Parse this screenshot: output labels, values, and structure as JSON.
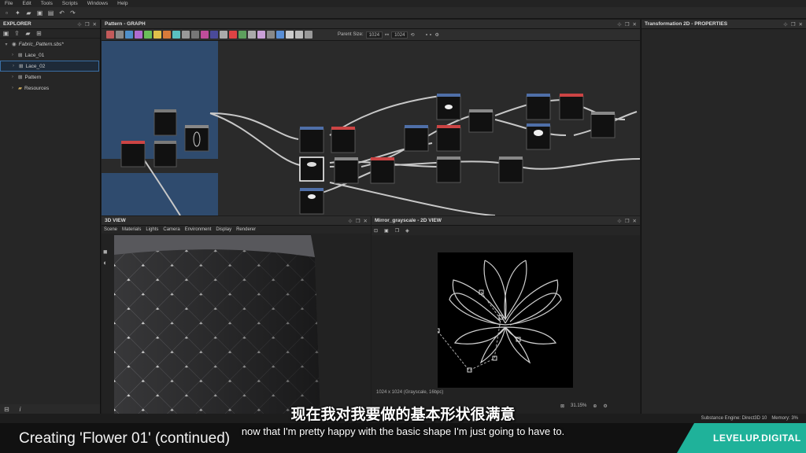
{
  "menu": [
    "File",
    "Edit",
    "Tools",
    "Scripts",
    "Windows",
    "Help"
  ],
  "explorer": {
    "title": "EXPLORER",
    "package": "Fabric_Pattern.sbs*",
    "items": [
      {
        "label": "Lace_01"
      },
      {
        "label": "Lace_02"
      },
      {
        "label": "Pattern"
      },
      {
        "label": "Resources"
      }
    ]
  },
  "graph": {
    "title": "Pattern - GRAPH",
    "parent_size_label": "Parent Size:",
    "parent_size_value": "1024",
    "size_value": "1024"
  },
  "view3d": {
    "title": "3D VIEW",
    "tabs": [
      "Scene",
      "Materials",
      "Lights",
      "Camera",
      "Environment",
      "Display",
      "Renderer"
    ]
  },
  "view2d": {
    "title": "Mirror_grayscale - 2D VIEW",
    "info": "1024 x 1024 (Grayscale, 16bpc)",
    "zoom": "31.15%"
  },
  "properties": {
    "title": "Transformation 2D - PROPERTIES"
  },
  "status": {
    "engine": "Substance Engine: Direct3D 10",
    "memory": "Memory: 3%"
  },
  "subtitles": {
    "chinese": "现在我对我要做的基本形状很满意",
    "english": "now that I'm pretty happy with the basic shape I'm just going to have to."
  },
  "caption": "Creating 'Flower 01' (continued)",
  "brand": "LEVELUP.DIGITAL",
  "colors": {
    "accent": "#1fb29a",
    "selection": "#3a6ea5",
    "frame_blue": "#2f4b6e"
  }
}
